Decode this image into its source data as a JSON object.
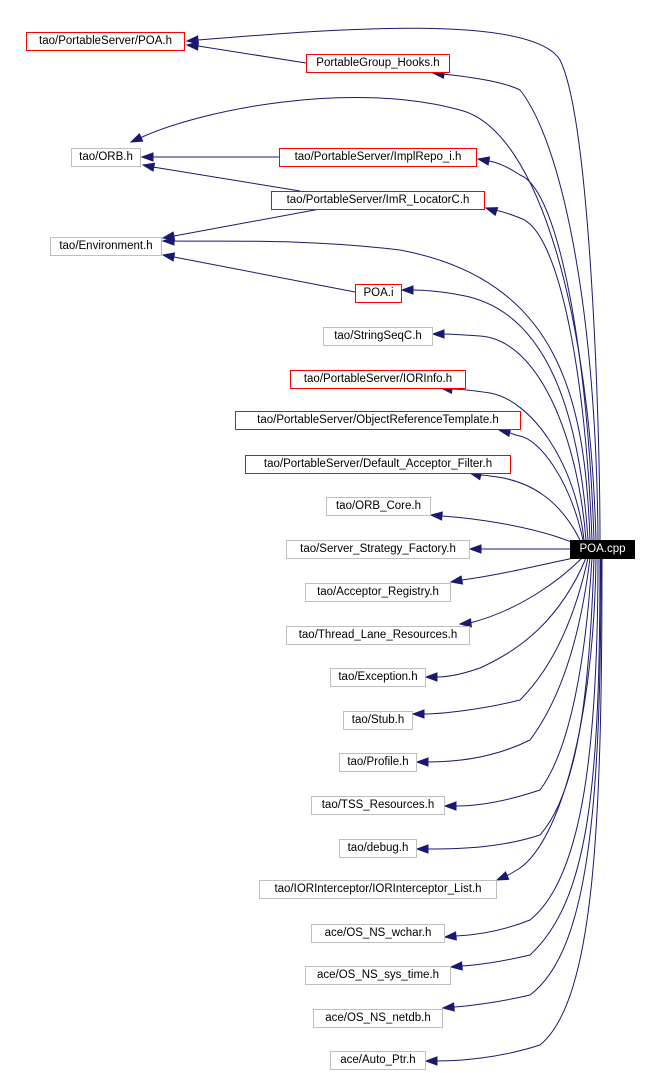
{
  "diagram": {
    "type": "include-dependency-graph",
    "root": {
      "id": "poa_cpp",
      "label": "POA.cpp"
    },
    "colors": {
      "edge": "#191970",
      "linked_border": "#ff0000",
      "plain_border": "#bfbfbf",
      "root_fill": "#000000",
      "root_text": "#ffffff"
    },
    "nodes": [
      {
        "id": "poa_h",
        "label": "tao/PortableServer/POA.h",
        "style": "red"
      },
      {
        "id": "pg_hooks",
        "label": "PortableGroup_Hooks.h",
        "style": "red"
      },
      {
        "id": "orb_h",
        "label": "tao/ORB.h",
        "style": "grey"
      },
      {
        "id": "implrepo",
        "label": "tao/PortableServer/ImplRepo_i.h",
        "style": "red"
      },
      {
        "id": "imr_locator",
        "label": "tao/PortableServer/ImR_LocatorC.h",
        "style": "red"
      },
      {
        "id": "environment",
        "label": "tao/Environment.h",
        "style": "grey"
      },
      {
        "id": "poa_i",
        "label": "POA.i",
        "style": "red"
      },
      {
        "id": "stringseq",
        "label": "tao/StringSeqC.h",
        "style": "grey"
      },
      {
        "id": "iorinfo",
        "label": "tao/PortableServer/IORInfo.h",
        "style": "red"
      },
      {
        "id": "ort",
        "label": "tao/PortableServer/ObjectReferenceTemplate.h",
        "style": "red"
      },
      {
        "id": "daf",
        "label": "tao/PortableServer/Default_Acceptor_Filter.h",
        "style": "red"
      },
      {
        "id": "orb_core",
        "label": "tao/ORB_Core.h",
        "style": "grey"
      },
      {
        "id": "ssf",
        "label": "tao/Server_Strategy_Factory.h",
        "style": "grey"
      },
      {
        "id": "acc_reg",
        "label": "tao/Acceptor_Registry.h",
        "style": "grey"
      },
      {
        "id": "tlr",
        "label": "tao/Thread_Lane_Resources.h",
        "style": "grey"
      },
      {
        "id": "exception",
        "label": "tao/Exception.h",
        "style": "grey"
      },
      {
        "id": "stub",
        "label": "tao/Stub.h",
        "style": "grey"
      },
      {
        "id": "profile",
        "label": "tao/Profile.h",
        "style": "grey"
      },
      {
        "id": "tss",
        "label": "tao/TSS_Resources.h",
        "style": "grey"
      },
      {
        "id": "debug",
        "label": "tao/debug.h",
        "style": "grey"
      },
      {
        "id": "iorint",
        "label": "tao/IORInterceptor/IORInterceptor_List.h",
        "style": "grey"
      },
      {
        "id": "wchar",
        "label": "ace/OS_NS_wchar.h",
        "style": "grey"
      },
      {
        "id": "systime",
        "label": "ace/OS_NS_sys_time.h",
        "style": "grey"
      },
      {
        "id": "netdb",
        "label": "ace/OS_NS_netdb.h",
        "style": "grey"
      },
      {
        "id": "autoptr",
        "label": "ace/Auto_Ptr.h",
        "style": "grey"
      }
    ],
    "edges": [
      [
        "poa_cpp",
        "poa_h"
      ],
      [
        "pg_hooks",
        "poa_h"
      ],
      [
        "poa_cpp",
        "pg_hooks"
      ],
      [
        "poa_cpp",
        "orb_h"
      ],
      [
        "implrepo",
        "orb_h"
      ],
      [
        "imr_locator",
        "orb_h"
      ],
      [
        "poa_cpp",
        "implrepo"
      ],
      [
        "poa_cpp",
        "imr_locator"
      ],
      [
        "imr_locator",
        "environment"
      ],
      [
        "poa_cpp",
        "environment"
      ],
      [
        "poa_i",
        "environment"
      ],
      [
        "poa_cpp",
        "poa_i"
      ],
      [
        "poa_cpp",
        "stringseq"
      ],
      [
        "poa_cpp",
        "iorinfo"
      ],
      [
        "poa_cpp",
        "ort"
      ],
      [
        "poa_cpp",
        "daf"
      ],
      [
        "poa_cpp",
        "orb_core"
      ],
      [
        "poa_cpp",
        "ssf"
      ],
      [
        "poa_cpp",
        "acc_reg"
      ],
      [
        "poa_cpp",
        "tlr"
      ],
      [
        "poa_cpp",
        "exception"
      ],
      [
        "poa_cpp",
        "stub"
      ],
      [
        "poa_cpp",
        "profile"
      ],
      [
        "poa_cpp",
        "tss"
      ],
      [
        "poa_cpp",
        "debug"
      ],
      [
        "poa_cpp",
        "iorint"
      ],
      [
        "poa_cpp",
        "wchar"
      ],
      [
        "poa_cpp",
        "systime"
      ],
      [
        "poa_cpp",
        "netdb"
      ],
      [
        "poa_cpp",
        "autoptr"
      ]
    ]
  }
}
